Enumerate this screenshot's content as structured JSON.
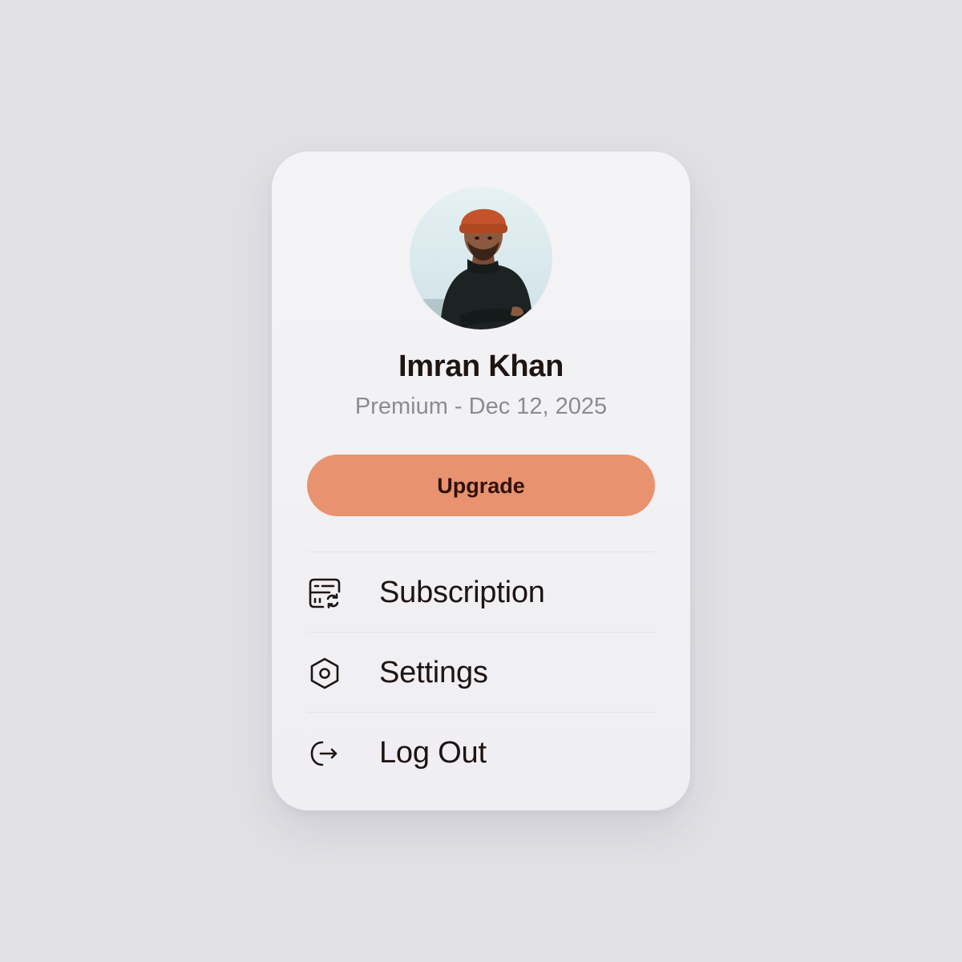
{
  "profile": {
    "name": "Imran Khan",
    "plan_line": "Premium - Dec 12, 2025",
    "avatar": "profile-photo"
  },
  "actions": {
    "upgrade_label": "Upgrade"
  },
  "menu": {
    "items": [
      {
        "label": "Subscription",
        "icon": "subscription-icon"
      },
      {
        "label": "Settings",
        "icon": "hexagon-settings-icon"
      },
      {
        "label": "Log Out",
        "icon": "logout-icon"
      }
    ]
  },
  "colors": {
    "background": "#e1e0e5",
    "card": "#f2f1f4",
    "accent": "#e8926f",
    "accent_text": "#2e1208",
    "primary_text": "#1e1412",
    "secondary_text": "#8d8b8d"
  }
}
